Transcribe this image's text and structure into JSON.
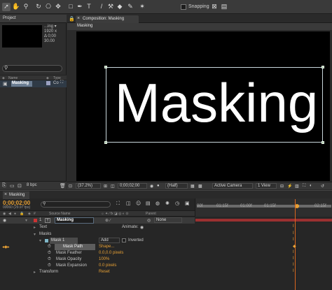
{
  "toolbar": {
    "tools": [
      "selection-tool",
      "hand-tool",
      "zoom-tool",
      "rotate-tool",
      "camera-tool",
      "pan-behind-tool",
      "rectangle-tool",
      "pen-tool",
      "type-tool",
      "brush-tool",
      "clone-stamp-tool",
      "eraser-tool",
      "roto-brush-tool",
      "puppet-tool"
    ],
    "snapping_label": "Snapping"
  },
  "project": {
    "tab_label": "Project",
    "info_lines": [
      "...ing ▾",
      "1920 x",
      "Δ 0;00",
      "30.00"
    ],
    "columns": {
      "name": "Name",
      "type": "Type"
    },
    "item": {
      "label": "Masking",
      "type": "Co"
    },
    "bpc_label": "8 bpc"
  },
  "composition": {
    "tab_label": "Composition: Masking",
    "breadcrumb": "Masking",
    "canvas_text": "Masking",
    "zoom": "(37.2%)",
    "timecode": "0;00;02;00",
    "resolution": "(Half)",
    "camera": "Active Camera",
    "view": "1 View"
  },
  "timeline": {
    "tab_label": "Masking",
    "current_time": "0;00;02;00",
    "fps": "00060 (29.97 fps)",
    "columns": {
      "source_name": "Source Name",
      "parent": "Parent"
    },
    "ruler_ticks": [
      "00f",
      "01:15f",
      "01:00f",
      "01:15f",
      "02:15f"
    ],
    "layer": {
      "index": "1",
      "name": "Masking",
      "parent": "None"
    },
    "text_label": "Text",
    "animate_label": "Animate:",
    "masks_label": "Masks",
    "mask": {
      "name": "Mask 1",
      "mode": "Add",
      "inverted_label": "Inverted"
    },
    "properties": [
      {
        "name": "Mask Path",
        "value": "Shape..."
      },
      {
        "name": "Mask Feather",
        "value": "0.0,0.0 pixels"
      },
      {
        "name": "Mask Opacity",
        "value": "100%"
      },
      {
        "name": "Mask Expansion",
        "value": "0.0 pixels"
      }
    ],
    "transform_label": "Transform",
    "transform_value": "Reset"
  }
}
